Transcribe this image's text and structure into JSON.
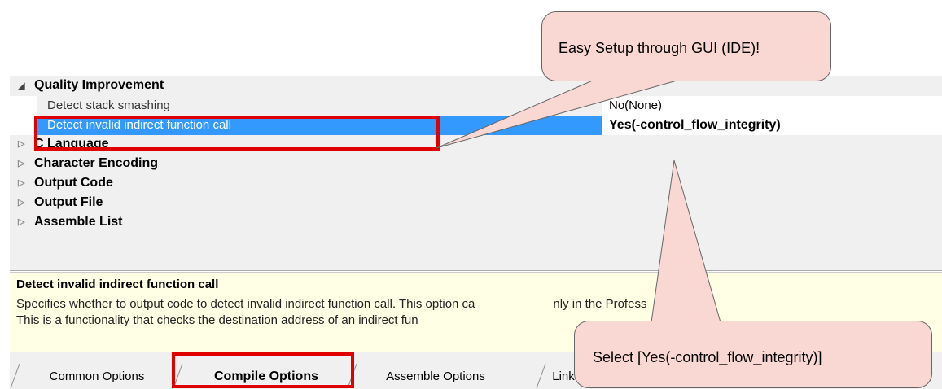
{
  "property_panel": {
    "categories": {
      "quality_improvement": "Quality Improvement",
      "c_language": "C Language",
      "character_encoding": "Character Encoding",
      "output_code": "Output Code",
      "output_file": "Output File",
      "assemble_list": "Assemble List"
    },
    "properties": [
      {
        "name": "Detect stack smashing",
        "value": "No(None)"
      },
      {
        "name": "Detect invalid indirect function call",
        "value": "Yes(-control_flow_integrity)",
        "selected": true
      }
    ]
  },
  "description": {
    "title": "Detect invalid indirect function call",
    "line1": "Specifies whether to output code to detect invalid indirect function call. This option ca",
    "line1_tail": "nly in the Profess",
    "line2": "This is a functionality that checks the destination address of an indirect fun"
  },
  "tabs": {
    "common": "Common Options",
    "compile": "Compile Options",
    "assemble": "Assemble Options",
    "link": "Link"
  },
  "callouts": {
    "setup": "Easy Setup through GUI (IDE)!",
    "select": "Select [Yes(-control_flow_integrity)]"
  },
  "colors": {
    "selection": "#3399ff",
    "highlight_box": "#e00000",
    "callout_fill": "#f9d8d4",
    "description_bg": "#ffffe6"
  }
}
